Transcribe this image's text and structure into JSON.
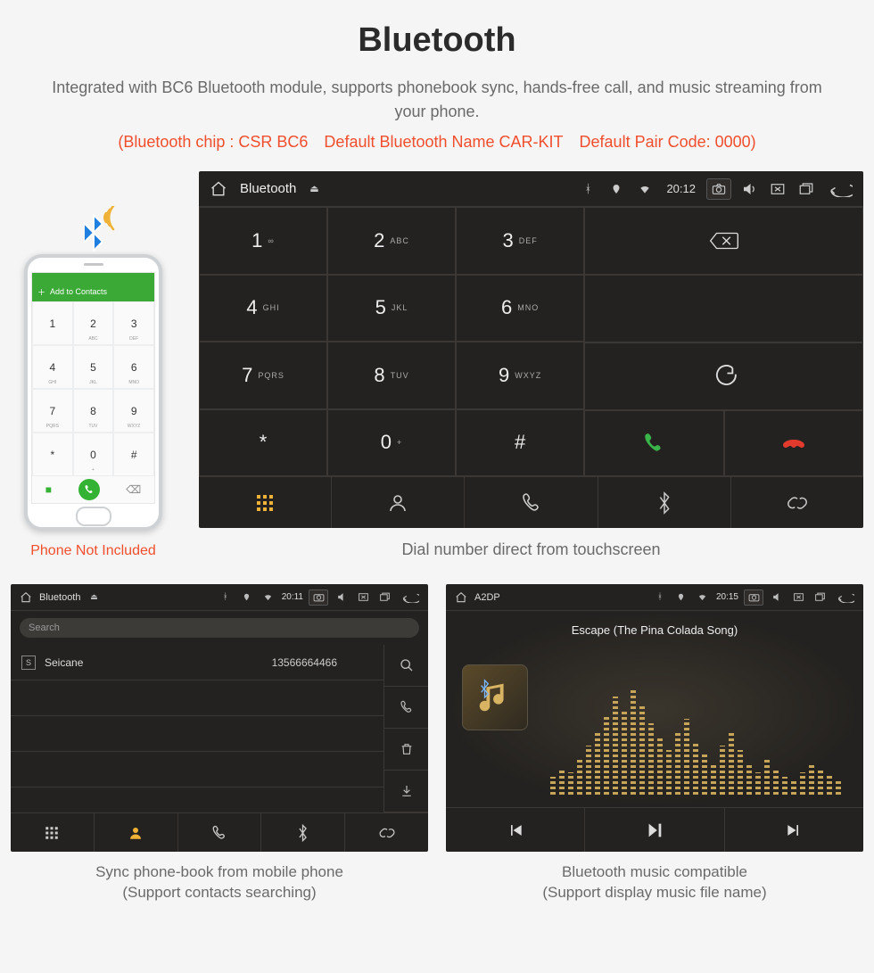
{
  "title": "Bluetooth",
  "desc": "Integrated with BC6 Bluetooth module, supports phonebook sync, hands-free call, and music streaming from your phone.",
  "red": "(Bluetooth chip : CSR BC6 Default Bluetooth Name CAR-KIT Default Pair Code: 0000)",
  "phone": {
    "header": "Add to Contacts",
    "note": "Phone Not Included",
    "keys": [
      {
        "n": "1",
        "s": ""
      },
      {
        "n": "2",
        "s": "ABC"
      },
      {
        "n": "3",
        "s": "DEF"
      },
      {
        "n": "4",
        "s": "GHI"
      },
      {
        "n": "5",
        "s": "JKL"
      },
      {
        "n": "6",
        "s": "MNO"
      },
      {
        "n": "7",
        "s": "PQRS"
      },
      {
        "n": "8",
        "s": "TUV"
      },
      {
        "n": "9",
        "s": "WXYZ"
      },
      {
        "n": "*",
        "s": ""
      },
      {
        "n": "0",
        "s": "+"
      },
      {
        "n": "#",
        "s": ""
      }
    ]
  },
  "hu1": {
    "title": "Bluetooth",
    "time": "20:12",
    "keys": [
      {
        "n": "1",
        "s": "∞"
      },
      {
        "n": "2",
        "s": "ABC"
      },
      {
        "n": "3",
        "s": "DEF"
      },
      {
        "n": "4",
        "s": "GHI"
      },
      {
        "n": "5",
        "s": "JKL"
      },
      {
        "n": "6",
        "s": "MNO"
      },
      {
        "n": "7",
        "s": "PQRS"
      },
      {
        "n": "8",
        "s": "TUV"
      },
      {
        "n": "9",
        "s": "WXYZ"
      },
      {
        "n": "*",
        "s": ""
      },
      {
        "n": "0",
        "s": "+"
      },
      {
        "n": "#",
        "s": ""
      }
    ],
    "caption": "Dial number direct from touchscreen"
  },
  "hu2": {
    "title": "Bluetooth",
    "time": "20:11",
    "search": "Search",
    "contact": {
      "letter": "S",
      "name": "Seicane",
      "number": "13566664466"
    },
    "caption1": "Sync phone-book from mobile phone",
    "caption2": "(Support contacts searching)"
  },
  "hu3": {
    "title": "A2DP",
    "time": "20:15",
    "song": "Escape (The Pina Colada Song)",
    "caption1": "Bluetooth music compatible",
    "caption2": "(Support display music file name)"
  }
}
